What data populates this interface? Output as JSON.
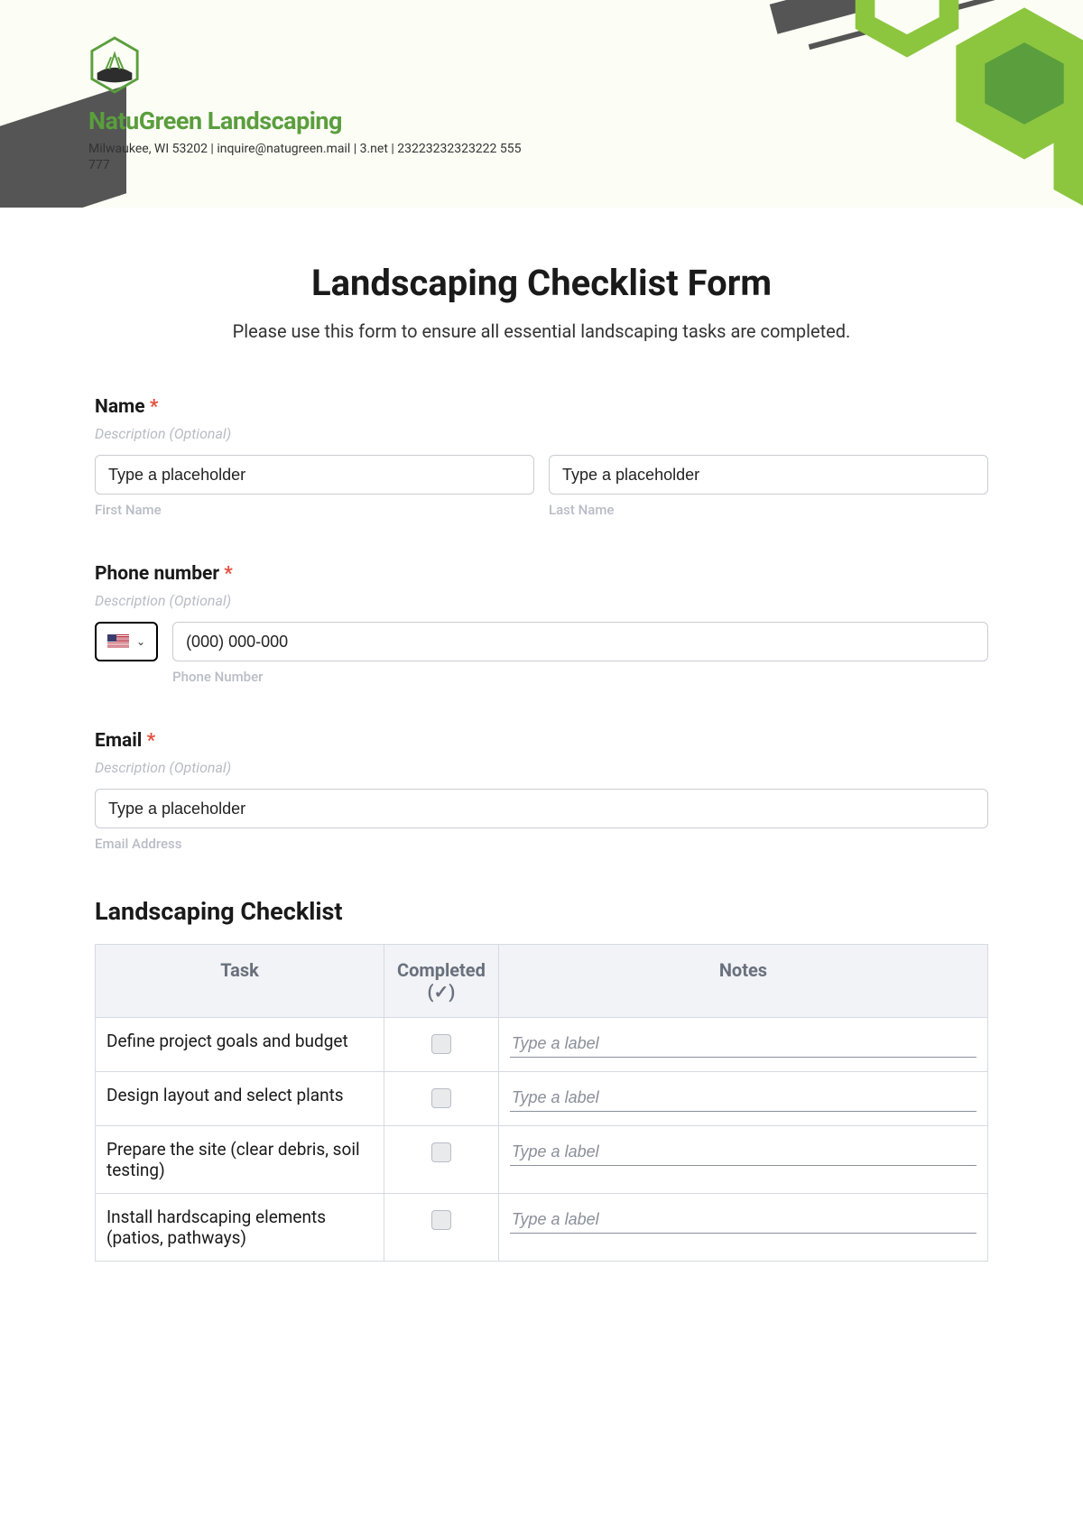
{
  "header": {
    "company": "NatuGreen Landscaping",
    "line": "Milwaukee, WI 53202 | inquire@natugreen.mail | 3.net | 23223232323222 555 777"
  },
  "form": {
    "title": "Landscaping Checklist Form",
    "subtitle": "Please use this form to ensure all essential landscaping tasks are completed."
  },
  "name": {
    "label": "Name",
    "desc": "Description (Optional)",
    "first_ph": "Type a placeholder",
    "last_ph": "Type a placeholder",
    "first_sub": "First Name",
    "last_sub": "Last Name"
  },
  "phone": {
    "label": "Phone number",
    "desc": "Description (Optional)",
    "ph": "(000) 000-000",
    "sub": "Phone Number"
  },
  "email": {
    "label": "Email",
    "desc": "Description (Optional)",
    "ph": "Type a placeholder",
    "sub": "Email Address"
  },
  "checklist": {
    "title": "Landscaping Checklist",
    "columns": {
      "task": "Task",
      "completed": "Completed (✓)",
      "notes": "Notes"
    },
    "note_ph": "Type a label",
    "rows": [
      {
        "task": "Define project goals and budget"
      },
      {
        "task": "Design layout and select plants"
      },
      {
        "task": "Prepare the site (clear debris, soil testing)"
      },
      {
        "task": "Install hardscaping elements (patios, pathways)"
      }
    ]
  }
}
